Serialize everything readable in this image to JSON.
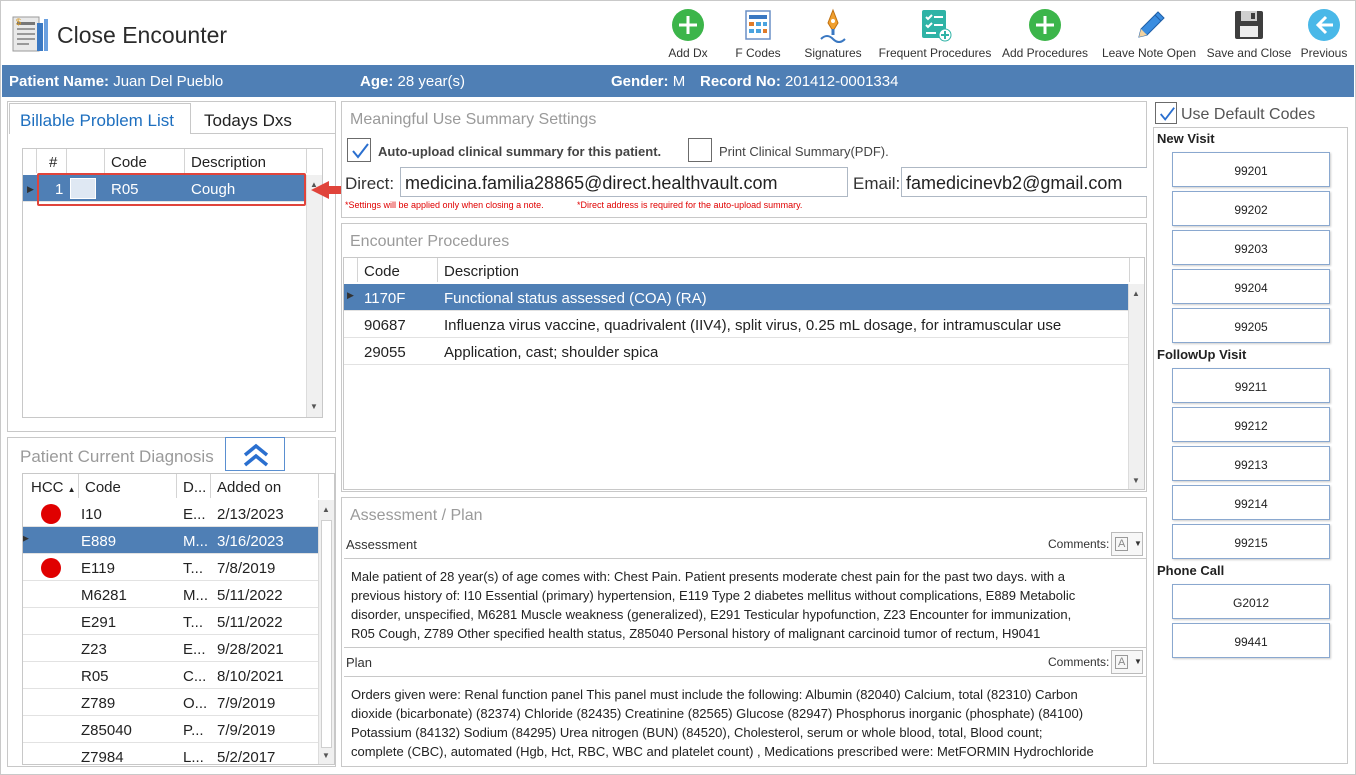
{
  "window": {
    "title": "Close Encounter"
  },
  "toolbar": [
    {
      "label": "Add Dx",
      "icon": "add-circle-icon"
    },
    {
      "label": "F Codes",
      "icon": "f-codes-icon"
    },
    {
      "label": "Signatures",
      "icon": "signature-pen-icon"
    },
    {
      "label": "Frequent Procedures",
      "icon": "frequent-procedures-icon"
    },
    {
      "label": "Add Procedures",
      "icon": "add-circle-icon"
    },
    {
      "label": "Leave Note Open",
      "icon": "pencil-icon"
    },
    {
      "label": "Save and Close",
      "icon": "floppy-disk-icon"
    },
    {
      "label": "Previous",
      "icon": "back-arrow-icon"
    }
  ],
  "patient": {
    "name_label": "Patient Name:",
    "name": "Juan Del Pueblo",
    "age_label": "Age:",
    "age": "28 year(s)",
    "gender_label": "Gender:",
    "gender": "M",
    "record_label": "Record No:",
    "record": "201412-0001334"
  },
  "problem_tabs": [
    "Billable Problem List",
    "Todays Dxs"
  ],
  "problem_list": {
    "headers": [
      "#",
      "",
      "Code",
      "Description"
    ],
    "rows": [
      {
        "num": "1",
        "code": "R05",
        "description": "Cough"
      }
    ]
  },
  "current_dx": {
    "title": "Patient Current Diagnosis",
    "headers": [
      "HCC",
      "Code",
      "D...",
      "Added on"
    ],
    "rows": [
      {
        "hcc": true,
        "code": "I10",
        "desc": "E...",
        "date": "2/13/2023"
      },
      {
        "hcc": false,
        "code": "E889",
        "desc": "M...",
        "date": "3/16/2023",
        "selected": true
      },
      {
        "hcc": true,
        "code": "E119",
        "desc": "T...",
        "date": "7/8/2019"
      },
      {
        "hcc": false,
        "code": "M6281",
        "desc": "M...",
        "date": "5/11/2022"
      },
      {
        "hcc": false,
        "code": "E291",
        "desc": "T...",
        "date": "5/11/2022"
      },
      {
        "hcc": false,
        "code": "Z23",
        "desc": "E...",
        "date": "9/28/2021"
      },
      {
        "hcc": false,
        "code": "R05",
        "desc": "C...",
        "date": "8/10/2021"
      },
      {
        "hcc": false,
        "code": "Z789",
        "desc": "O...",
        "date": "7/9/2019"
      },
      {
        "hcc": false,
        "code": "Z85040",
        "desc": "P...",
        "date": "7/9/2019"
      },
      {
        "hcc": false,
        "code": "Z7984",
        "desc": "L...",
        "date": "5/2/2017"
      }
    ]
  },
  "mu": {
    "title": "Meaningful Use Summary Settings",
    "auto_upload_label": "Auto-upload clinical summary for this patient.",
    "auto_upload_checked": true,
    "print_label": "Print Clinical Summary(PDF).",
    "print_checked": false,
    "direct_label": "Direct:",
    "direct_value": "medicina.familia28865@direct.healthvault.com",
    "email_label": "Email:",
    "email_value": "famedicinevb2@gmail.com",
    "note1": "*Settings will be applied only when closing a note.",
    "note2": "*Direct address is required for the auto-upload summary."
  },
  "procedures": {
    "title": "Encounter Procedures",
    "headers": [
      "Code",
      "Description"
    ],
    "rows": [
      {
        "code": "1170F",
        "description": "Functional status assessed (COA) (RA)",
        "selected": true
      },
      {
        "code": "90687",
        "description": "Influenza virus vaccine, quadrivalent (IIV4), split virus, 0.25 mL dosage, for intramuscular use"
      },
      {
        "code": "29055",
        "description": "Application, cast; shoulder spica"
      }
    ]
  },
  "assessment_plan": {
    "title": "Assessment / Plan",
    "assessment_label": "Assessment",
    "plan_label": "Plan",
    "comments_label": "Comments:",
    "assessment_lines": [
      "Male patient of 28 year(s) of age comes with:  Chest Pain. Patient presents moderate chest pain for the past two days.   with a",
      "previous history of: I10 Essential (primary) hypertension, E119 Type 2 diabetes mellitus without complications, E889 Metabolic",
      "disorder, unspecified, M6281 Muscle weakness (generalized), E291 Testicular hypofunction, Z23 Encounter for immunization,",
      "R05 Cough, Z789 Other specified health status, Z85040 Personal history of malignant carcinoid tumor of rectum, H9041"
    ],
    "plan_lines": [
      "Orders given were: Renal function panel This panel must include the following: Albumin (82040) Calcium, total (82310) Carbon",
      "dioxide (bicarbonate) (82374) Chloride (82435) Creatinine (82565) Glucose (82947) Phosphorus inorganic (phosphate) (84100)",
      "Potassium (84132) Sodium (84295) Urea nitrogen (BUN) (84520), Cholesterol, serum or whole blood, total, Blood count;",
      "complete (CBC), automated (Hgb, Hct, RBC, WBC and platelet count) , Medications prescribed were: MetFORMIN Hydrochloride"
    ]
  },
  "codes": {
    "use_default_label": "Use Default Codes",
    "use_default_checked": true,
    "groups": [
      {
        "label": "New Visit",
        "codes": [
          "99201",
          "99202",
          "99203",
          "99204",
          "99205"
        ]
      },
      {
        "label": "FollowUp Visit",
        "codes": [
          "99211",
          "99212",
          "99213",
          "99214",
          "99215"
        ]
      },
      {
        "label": "Phone Call",
        "codes": [
          "G2012",
          "99441"
        ]
      }
    ]
  },
  "colors": {
    "accent": "#4f7fb5",
    "hcc_dot": "#e00000",
    "highlight": "#e0443b",
    "link_blue": "#1e6fbf"
  }
}
